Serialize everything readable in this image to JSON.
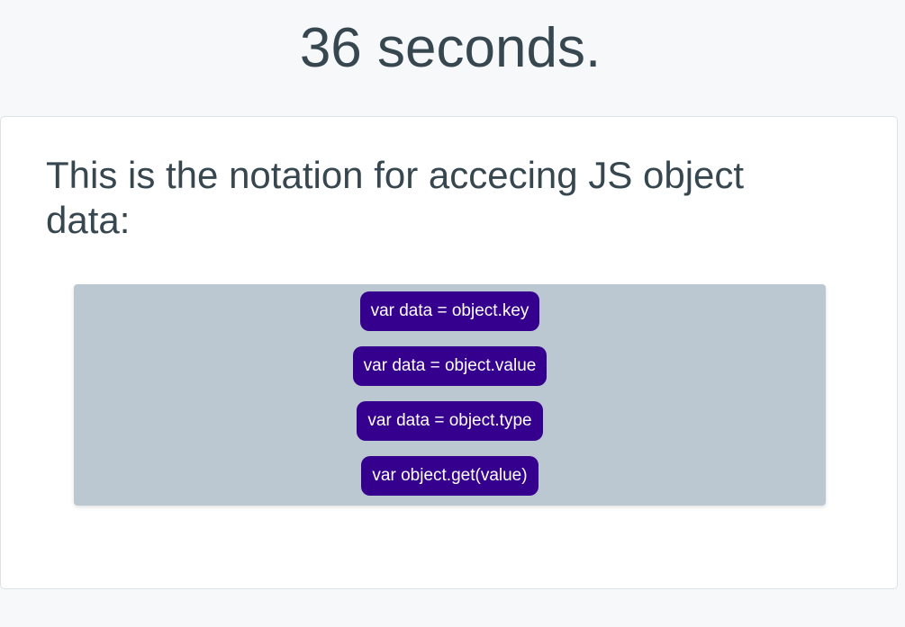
{
  "timer": {
    "text": "36 seconds."
  },
  "question": {
    "text": "This is the notation for accecing JS object data:"
  },
  "answers": [
    {
      "label": "var data = object.key"
    },
    {
      "label": "var data = object.value"
    },
    {
      "label": "var data = object.type"
    },
    {
      "label": "var object.get(value)"
    }
  ],
  "colors": {
    "page_background": "#f7f8fa",
    "card_background": "#ffffff",
    "answers_panel_background": "#bcc8d1",
    "answer_button_background": "#35008d",
    "answer_button_text": "#ffffff",
    "text": "#37474f"
  }
}
